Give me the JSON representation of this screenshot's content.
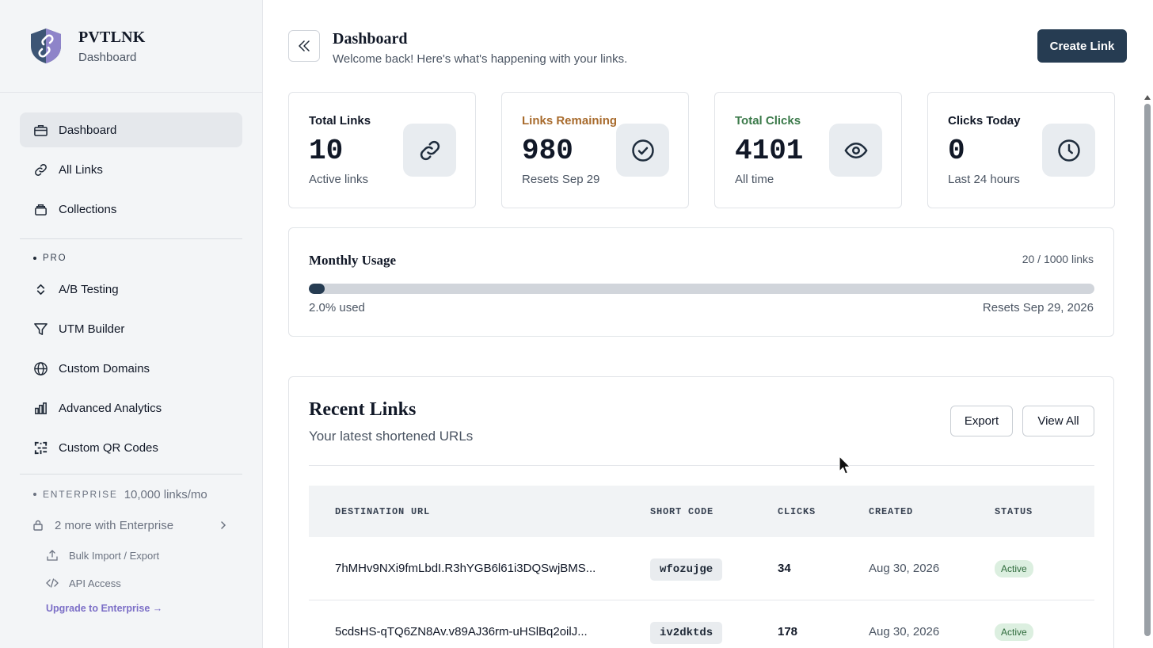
{
  "sidebar": {
    "brand": {
      "name": "PVTLNK",
      "subtitle": "Dashboard"
    },
    "nav": [
      {
        "label": "Dashboard",
        "icon": "briefcase-icon",
        "active": true
      },
      {
        "label": "All Links",
        "icon": "link-icon"
      },
      {
        "label": "Collections",
        "icon": "collections-icon"
      }
    ],
    "pro_label": "PRO",
    "pro_items": [
      {
        "label": "A/B Testing",
        "icon": "updown-icon"
      },
      {
        "label": "UTM Builder",
        "icon": "funnel-icon"
      },
      {
        "label": "Custom Domains",
        "icon": "globe-icon"
      },
      {
        "label": "Advanced Analytics",
        "icon": "bar-chart-icon"
      },
      {
        "label": "Custom QR Codes",
        "icon": "qr-icon"
      }
    ],
    "enterprise_label": "ENTERPRISE",
    "enterprise_count": "10,000 links/mo",
    "more_label": "2 more with Enterprise",
    "enterprise_items": [
      {
        "label": "Bulk Import / Export",
        "icon": "upload-icon"
      },
      {
        "label": "API Access",
        "icon": "code-icon"
      }
    ],
    "upgrade_label": "Upgrade to Enterprise →"
  },
  "header": {
    "title": "Dashboard",
    "subtitle": "Welcome back! Here's what's happening with your links.",
    "create_label": "Create Link"
  },
  "stats": [
    {
      "title": "Total Links",
      "value": "10",
      "caption": "Active links",
      "title_color": "#111827",
      "icon": "link-icon"
    },
    {
      "title": "Links Remaining",
      "value": "980",
      "caption": "Resets Sep 29",
      "title_color": "#a86b2d",
      "icon": "check-circle-icon"
    },
    {
      "title": "Total Clicks",
      "value": "4101",
      "caption": "All time",
      "title_color": "#3b7a4a",
      "icon": "eye-icon"
    },
    {
      "title": "Clicks Today",
      "value": "0",
      "caption": "Last 24 hours",
      "title_color": "#111827",
      "icon": "clock-icon"
    }
  ],
  "usage": {
    "title": "Monthly Usage",
    "count": "20 / 1000 links",
    "percent": 2.0,
    "used_label": "2.0% used",
    "reset_label": "Resets Sep 29, 2026"
  },
  "recent": {
    "title": "Recent Links",
    "subtitle": "Your latest shortened URLs",
    "export_label": "Export",
    "view_all_label": "View All",
    "columns": [
      "DESTINATION URL",
      "SHORT CODE",
      "CLICKS",
      "CREATED",
      "STATUS"
    ],
    "rows": [
      {
        "url": "7hMHv9NXi9fmLbdI.R3hYGB6l61i3DQSwjBMS...",
        "code": "wfozujge",
        "clicks": "34",
        "created": "Aug 30, 2026",
        "status": "Active"
      },
      {
        "url": "5cdsHS-qTQ6ZN8Av.v89AJ36rm-uHSlBq2oilJ...",
        "code": "iv2dktds",
        "clicks": "178",
        "created": "Aug 30, 2026",
        "status": "Active"
      }
    ]
  },
  "colors": {
    "primary": "#263c52",
    "sidebar_bg": "#f3f5f7",
    "accent_purple": "#7c6fc7"
  }
}
